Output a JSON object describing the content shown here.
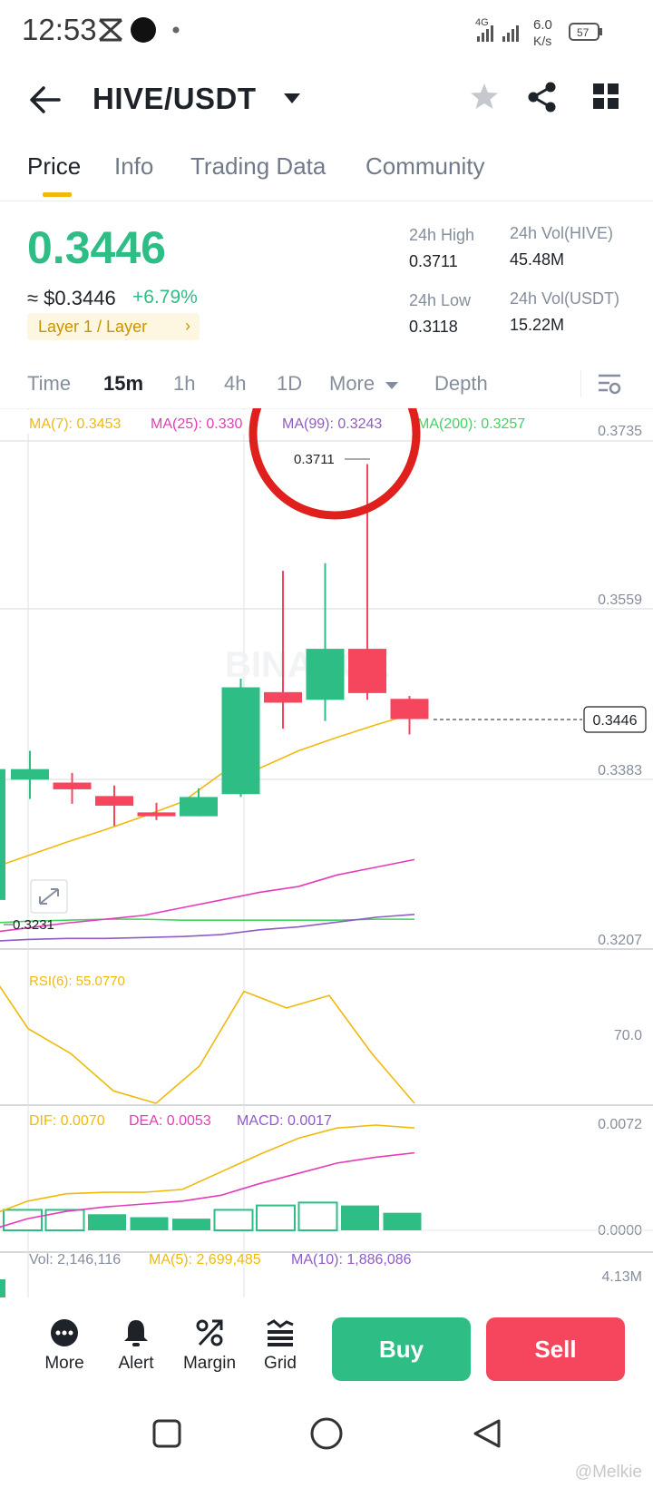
{
  "status_bar": {
    "time": "12:53",
    "network": "4G",
    "speed_value": "6.0",
    "speed_unit": "K/s",
    "battery": "57"
  },
  "header": {
    "pair": "HIVE/USDT"
  },
  "tabs": [
    {
      "label": "Price",
      "active": true
    },
    {
      "label": "Info"
    },
    {
      "label": "Trading Data"
    },
    {
      "label": "Community"
    }
  ],
  "price": {
    "last": "0.3446",
    "usd": "≈ $0.3446",
    "change": "+6.79%",
    "tag": "Layer 1 / Layer",
    "tag_arrow": "›"
  },
  "stats": {
    "high_label": "24h High",
    "high_value": "0.3711",
    "low_label": "24h Low",
    "low_value": "0.3118",
    "vol_base_label": "24h Vol(HIVE)",
    "vol_base_value": "45.48M",
    "vol_quote_label": "24h Vol(USDT)",
    "vol_quote_value": "15.22M"
  },
  "intervals": {
    "time": "Time",
    "m15": "15m",
    "h1": "1h",
    "h4": "4h",
    "d1": "1D",
    "more": "More",
    "depth": "Depth"
  },
  "chart_data": {
    "type": "candlestick",
    "ma_legend": [
      {
        "label": "MA(7): 0.3453",
        "color": "#f0b90b"
      },
      {
        "label": "MA(25): 0.330",
        "color": "#e63bb8"
      },
      {
        "label": "MA(99): 0.3243",
        "color": "#8e5cc4"
      },
      {
        "label": "MA(200): 0.3257",
        "color": "#3ed45e"
      }
    ],
    "price_axis": [
      "0.3735",
      "0.3559",
      "0.3383",
      "0.3207"
    ],
    "ylim": [
      0.3207,
      0.3735
    ],
    "last_price_tag": "0.3446",
    "high_marker": "0.3711",
    "low_marker": "0.3231",
    "candles": [
      {
        "o": 0.3383,
        "h": 0.3413,
        "l": 0.3363,
        "c": 0.3394
      },
      {
        "o": 0.338,
        "h": 0.339,
        "l": 0.3358,
        "c": 0.3373
      },
      {
        "o": 0.3366,
        "h": 0.3377,
        "l": 0.3335,
        "c": 0.3356
      },
      {
        "o": 0.3349,
        "h": 0.3359,
        "l": 0.3341,
        "c": 0.3345
      },
      {
        "o": 0.3345,
        "h": 0.3374,
        "l": 0.3345,
        "c": 0.3365
      },
      {
        "o": 0.3368,
        "h": 0.3488,
        "l": 0.3365,
        "c": 0.3479
      },
      {
        "o": 0.3474,
        "h": 0.36,
        "l": 0.3436,
        "c": 0.3463
      },
      {
        "o": 0.3466,
        "h": 0.3608,
        "l": 0.3444,
        "c": 0.3519
      },
      {
        "o": 0.3519,
        "h": 0.3711,
        "l": 0.3466,
        "c": 0.3473
      },
      {
        "o": 0.3467,
        "h": 0.347,
        "l": 0.343,
        "c": 0.3446
      }
    ],
    "ma7": [
      0.329,
      0.3304,
      0.3318,
      0.3331,
      0.3345,
      0.336,
      0.3389,
      0.3395,
      0.3413,
      0.3427,
      0.344,
      0.3452
    ],
    "ma25": [
      0.3224,
      0.3229,
      0.3234,
      0.3238,
      0.3242,
      0.325,
      0.3258,
      0.3266,
      0.3272,
      0.3284,
      0.3292,
      0.33
    ],
    "ma99": [
      0.3215,
      0.3217,
      0.3218,
      0.3218,
      0.3219,
      0.322,
      0.3222,
      0.3227,
      0.323,
      0.3235,
      0.324,
      0.3243
    ],
    "ma200": [
      0.3234,
      0.3236,
      0.3237,
      0.3238,
      0.3238,
      0.3237,
      0.3237,
      0.3237,
      0.3237,
      0.3237,
      0.3238,
      0.3238
    ],
    "rsi_label": "RSI(6): 55.0770",
    "rsi_axis": "70.0",
    "rsi": [
      82,
      68,
      62,
      53,
      50,
      59,
      77,
      73,
      76,
      62,
      50
    ],
    "macd_labels": [
      {
        "label": "DIF: 0.0070",
        "color": "#f0b90b"
      },
      {
        "label": "DEA: 0.0053",
        "color": "#e63bb8"
      },
      {
        "label": "MACD: 0.0017",
        "color": "#8e5cc4"
      }
    ],
    "macd_axis": [
      "0.0072",
      "0.0000"
    ],
    "dif": [
      0.001,
      0.002,
      0.0025,
      0.0026,
      0.0026,
      0.0028,
      0.004,
      0.0052,
      0.0063,
      0.007,
      0.0072,
      0.007
    ],
    "dea": [
      0.0,
      0.0008,
      0.0013,
      0.0016,
      0.0018,
      0.002,
      0.0024,
      0.0032,
      0.0039,
      0.0046,
      0.005,
      0.0053
    ],
    "macd_hist": [
      {
        "v": 0.0014,
        "hollow": true
      },
      {
        "v": 0.0014,
        "hollow": true
      },
      {
        "v": 0.0011,
        "hollow": false
      },
      {
        "v": 0.0009,
        "hollow": false
      },
      {
        "v": 0.0008,
        "hollow": false
      },
      {
        "v": 0.0014,
        "hollow": true
      },
      {
        "v": 0.0017,
        "hollow": true
      },
      {
        "v": 0.0019,
        "hollow": true
      },
      {
        "v": 0.0017,
        "hollow": false
      },
      {
        "v": 0.0012,
        "hollow": false
      }
    ],
    "vol_labels": [
      {
        "label": "Vol: 2,146,116",
        "color": "#848e9c"
      },
      {
        "label": "MA(5): 2,699,485",
        "color": "#f0b90b"
      },
      {
        "label": "MA(10): 1,886,086",
        "color": "#8e5cc4"
      }
    ],
    "vol_axis": "4.13M"
  },
  "bottom": {
    "more": "More",
    "alert": "Alert",
    "margin": "Margin",
    "grid": "Grid",
    "buy": "Buy",
    "sell": "Sell"
  },
  "colors": {
    "green": "#2ebd85",
    "red": "#f6465d",
    "yellow": "#f0b90b",
    "annotation": "#e0201c"
  },
  "watermark": "@Melkie"
}
